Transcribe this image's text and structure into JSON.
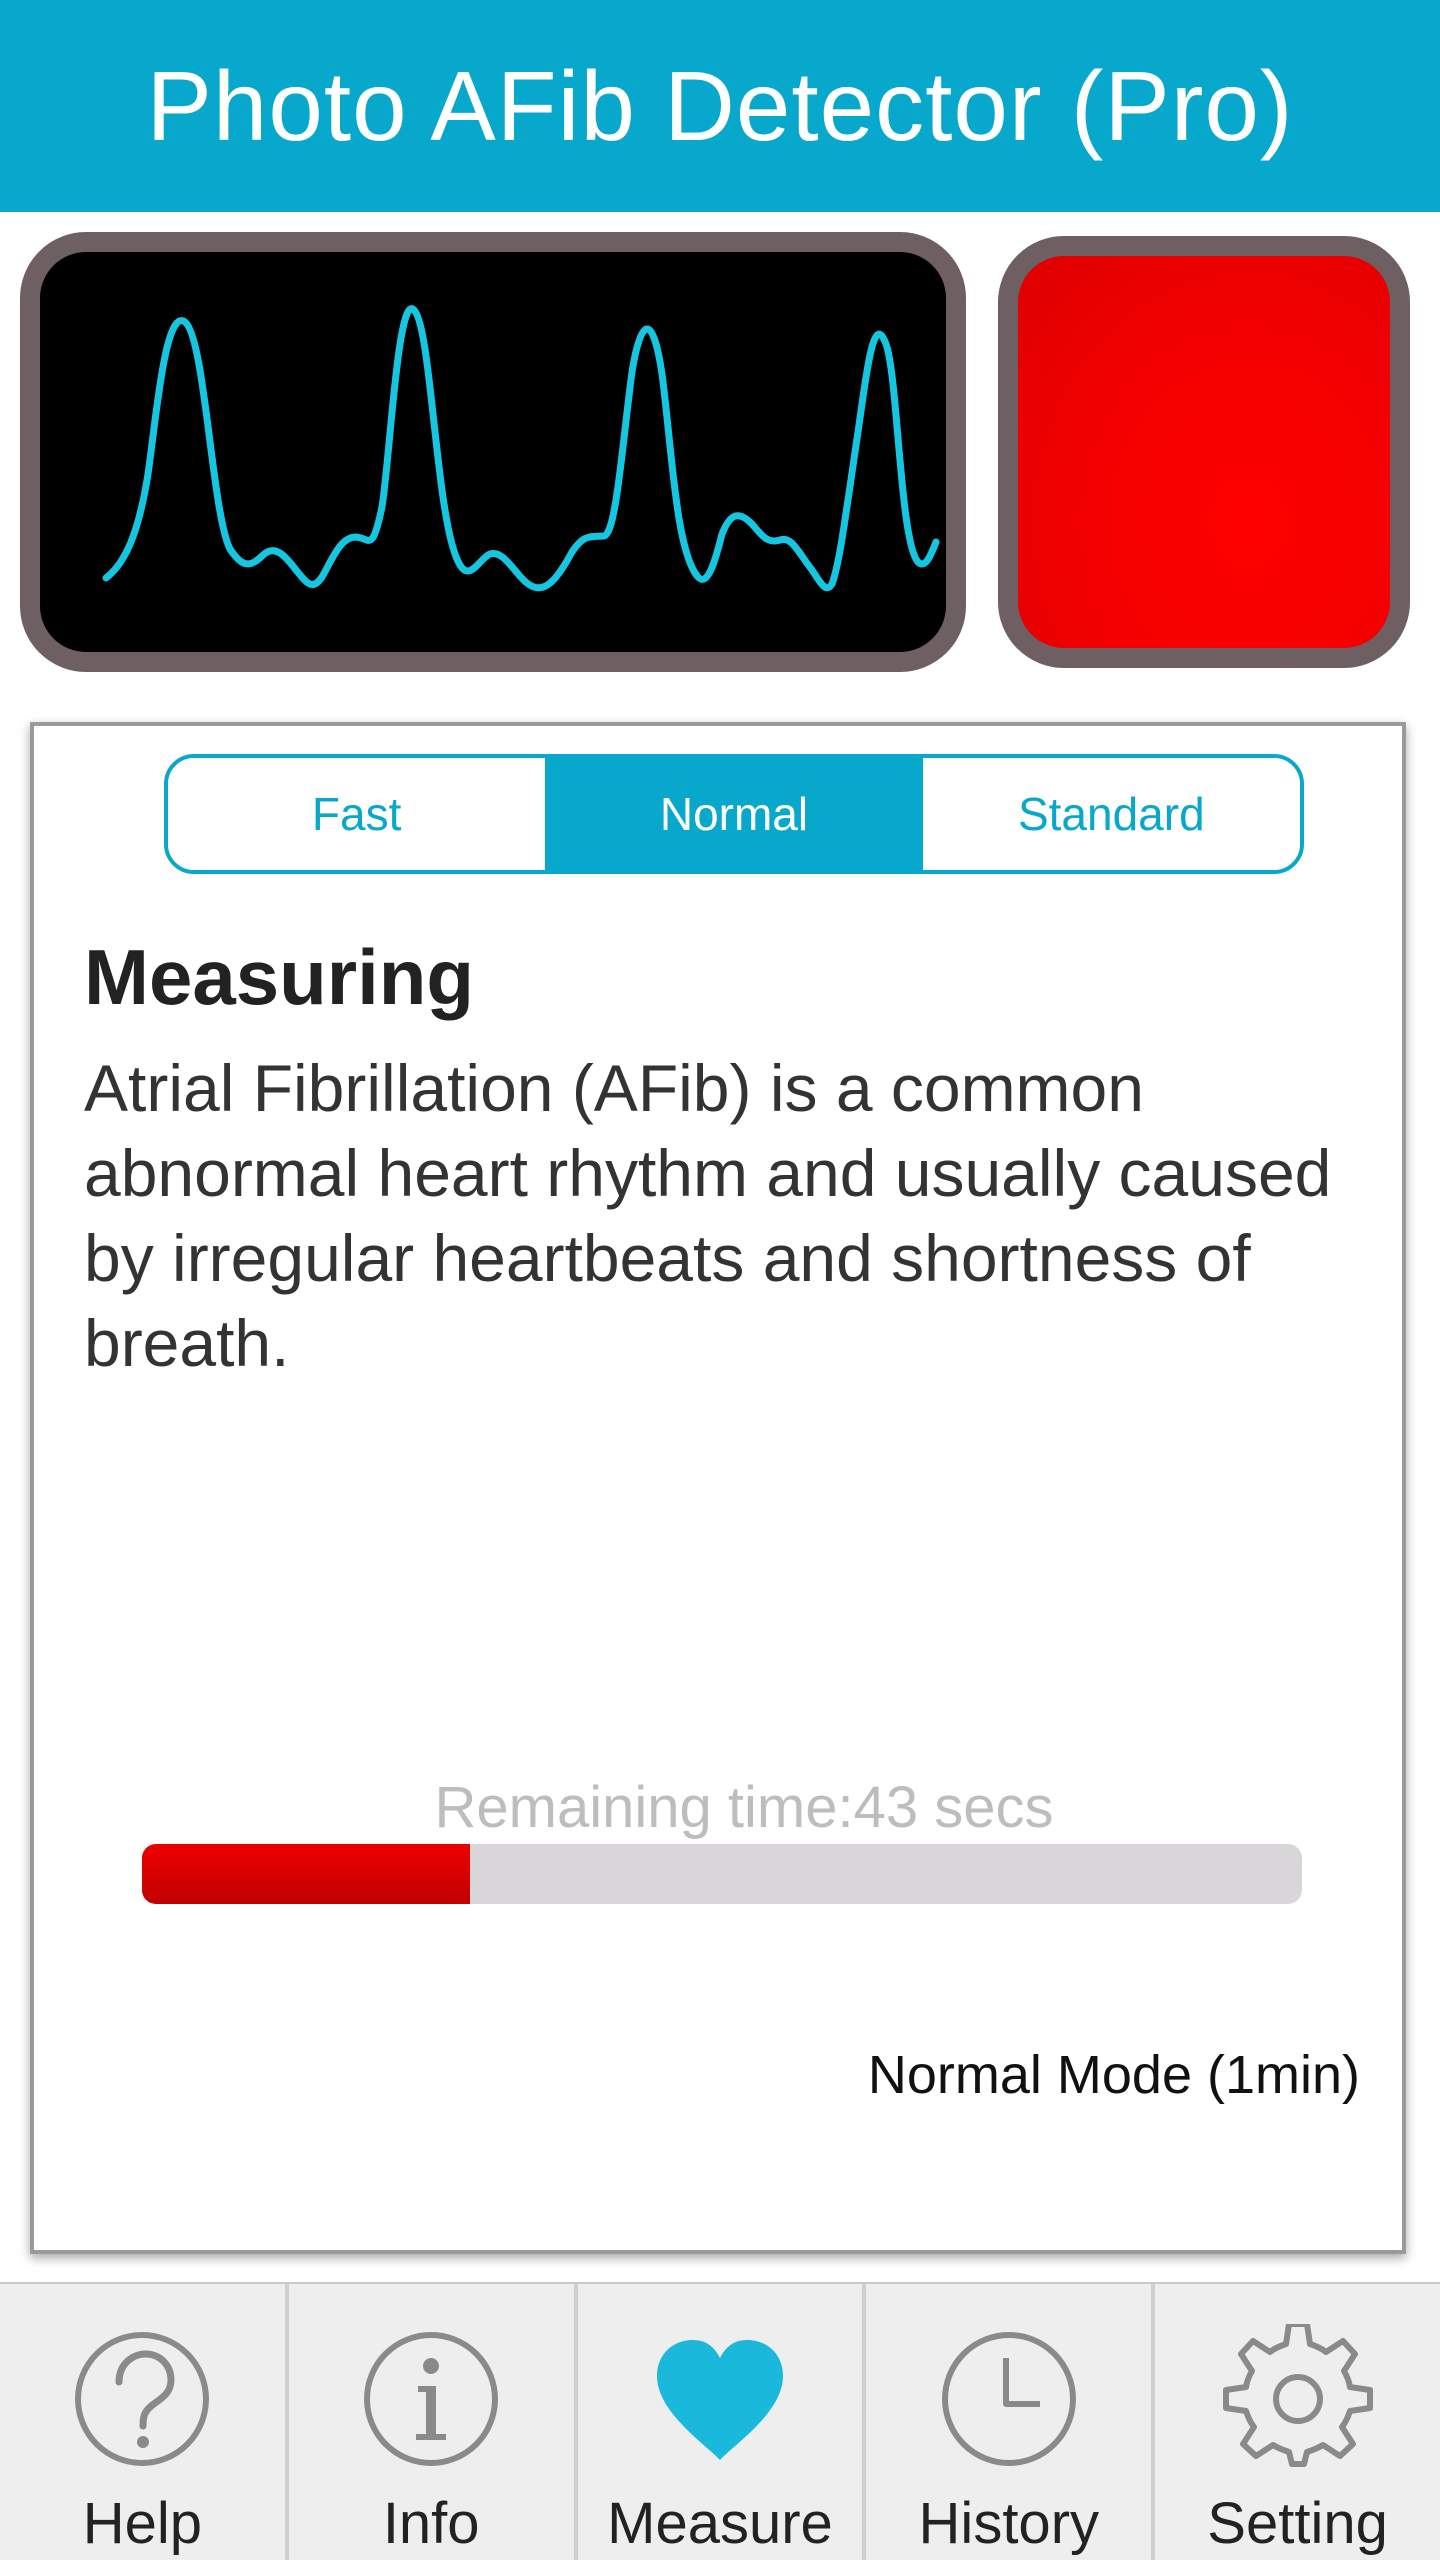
{
  "app_bar": {
    "title": "Photo AFib Detector (Pro)"
  },
  "colors": {
    "accent": "#08a8cc",
    "waveform": "#16c5e0",
    "camera_red": "#ff0000",
    "frame": "#6e6062",
    "progress_fill": "#dd0000",
    "progress_track": "#d8d6d8"
  },
  "mode_selector": {
    "options": [
      {
        "label": "Fast",
        "selected": false
      },
      {
        "label": "Normal",
        "selected": true
      },
      {
        "label": "Standard",
        "selected": false
      }
    ]
  },
  "measurement": {
    "title": "Measuring",
    "description": "Atrial Fibrillation (AFib) is a common abnormal heart rhythm and usually caused by irregular heartbeats and shortness of breath.",
    "remaining_text": "Remaining time:43 secs",
    "progress_fraction": 0.283,
    "mode_label": "Normal Mode (1min)"
  },
  "bottom_nav": {
    "items": [
      {
        "label": "Help",
        "icon": "question-circle-icon",
        "active": false
      },
      {
        "label": "Info",
        "icon": "info-circle-icon",
        "active": false
      },
      {
        "label": "Measure",
        "icon": "heart-icon",
        "active": true
      },
      {
        "label": "History",
        "icon": "clock-icon",
        "active": false
      },
      {
        "label": "Setting",
        "icon": "gear-icon",
        "active": false
      }
    ]
  }
}
